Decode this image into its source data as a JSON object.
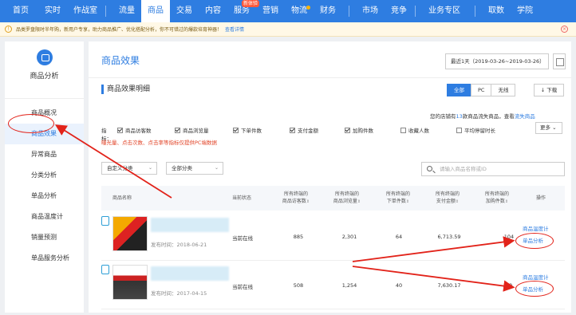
{
  "topnav": {
    "items": [
      {
        "label": "首页"
      },
      {
        "label": "实时"
      },
      {
        "label": "作战室"
      },
      {
        "label": "流量"
      },
      {
        "label": "商品"
      },
      {
        "label": "交易"
      },
      {
        "label": "内容"
      },
      {
        "label": "服务"
      },
      {
        "label": "营销"
      },
      {
        "label": "物流"
      },
      {
        "label": "财务"
      },
      {
        "label": "市场"
      },
      {
        "label": "竞争"
      },
      {
        "label": "业务专区"
      },
      {
        "label": "取数"
      },
      {
        "label": "学院"
      }
    ],
    "active_index": 4,
    "badge": "新体验"
  },
  "notice": {
    "text": "品类罗盘限时半年购，新用户专享，助力商品推广、优化搭配分析，你不可错过的爆款培育神器！",
    "link": "查看详情"
  },
  "sidebar": {
    "title": "商品分析",
    "items": [
      {
        "label": "商品概况"
      },
      {
        "label": "商品效果"
      },
      {
        "label": "异常商品"
      },
      {
        "label": "分类分析"
      },
      {
        "label": "单品分析"
      },
      {
        "label": "商品温度计"
      },
      {
        "label": "销量预测"
      },
      {
        "label": "单品服务分析"
      }
    ],
    "active_index": 1
  },
  "main": {
    "title": "商品效果",
    "date_range": "最近1天（2019-03-26~2019-03-26）",
    "section_title": "商品效果明细",
    "device_tabs": [
      "全部",
      "PC",
      "无线"
    ],
    "active_tab": 0,
    "download_label": "下载",
    "promo": {
      "prefix": "您的店铺有",
      "count": "13",
      "suffix": "款商品流失商品，查看",
      "link": "流失商品"
    },
    "indicators": {
      "label": "指标：",
      "items": [
        {
          "label": "商品访客数",
          "checked": true
        },
        {
          "label": "商品浏览量",
          "checked": true
        },
        {
          "label": "下单件数",
          "checked": true
        },
        {
          "label": "支付金额",
          "checked": true
        },
        {
          "label": "加购件数",
          "checked": true
        },
        {
          "label": "收藏人数",
          "checked": false
        },
        {
          "label": "平均停留时长",
          "checked": false
        }
      ],
      "note": "曝光量、点击次数、点击率等指标仅提供PC端数据",
      "more_label": "更多"
    },
    "filters": {
      "select1": "自定义分类",
      "select2": "全部分类",
      "search_placeholder": "请输入商品名称或ID"
    },
    "table": {
      "headers": [
        "商品名称",
        "当前状态",
        "所有终端的\n商品访客数",
        "所有终端的\n商品浏览量",
        "所有终端的\n下单件数",
        "所有终端的\n支付金额",
        "所有终端的\n加购件数",
        "操作"
      ],
      "rows": [
        {
          "publish_time": "发布时间：2018-06-21",
          "status": "当前在线",
          "visitors": "885",
          "pageviews": "2,301",
          "orders": "64",
          "payment": "6,713.59",
          "carts": "104",
          "op1": "商品温度计",
          "op2": "单品分析"
        },
        {
          "publish_time": "发布时间：2017-04-15",
          "status": "当前在线",
          "visitors": "508",
          "pageviews": "1,254",
          "orders": "40",
          "payment": "7,630.17",
          "carts": "50",
          "op1": "商品温度计",
          "op2": "单品分析"
        }
      ]
    }
  },
  "colors": {
    "accent": "#2e7de1",
    "annotation": "#e2231a",
    "warning": "#e2462a"
  }
}
